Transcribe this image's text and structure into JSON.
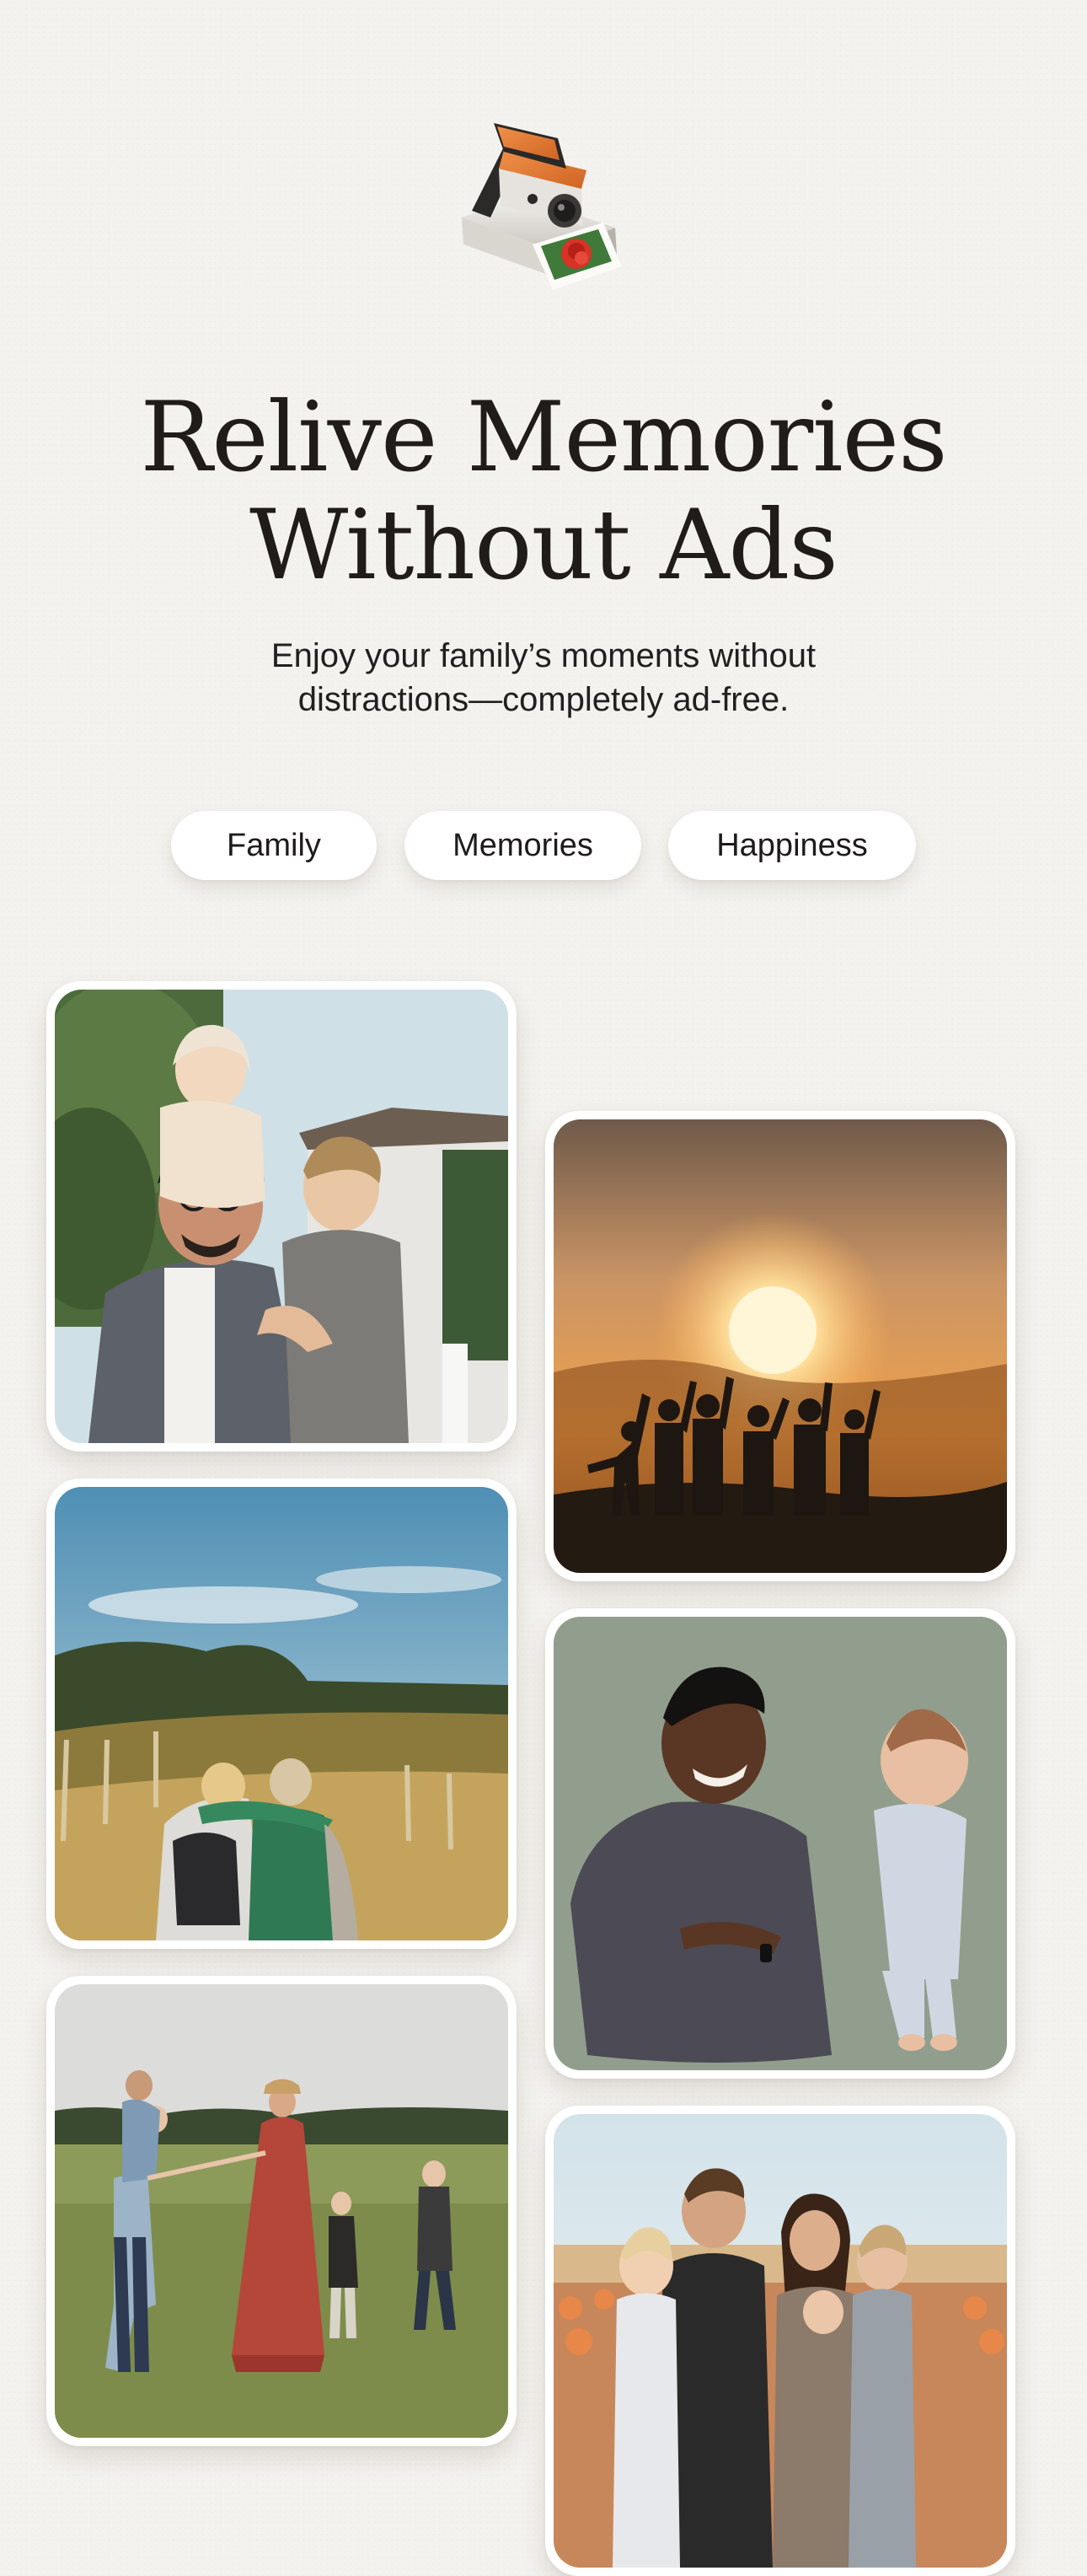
{
  "hero": {
    "icon": "instant-camera-icon",
    "title_line1": "Relive Memories",
    "title_line2": "Without Ads",
    "subtitle_line1": "Enjoy your family’s moments without",
    "subtitle_line2": "distractions—completely ad-free."
  },
  "chips": [
    {
      "label": "Family"
    },
    {
      "label": "Memories"
    },
    {
      "label": "Happiness"
    }
  ],
  "colors": {
    "background": "#f4f2ee",
    "card": "#ffffff",
    "text": "#1f1c1a",
    "camera_accent": "#e0782e"
  }
}
